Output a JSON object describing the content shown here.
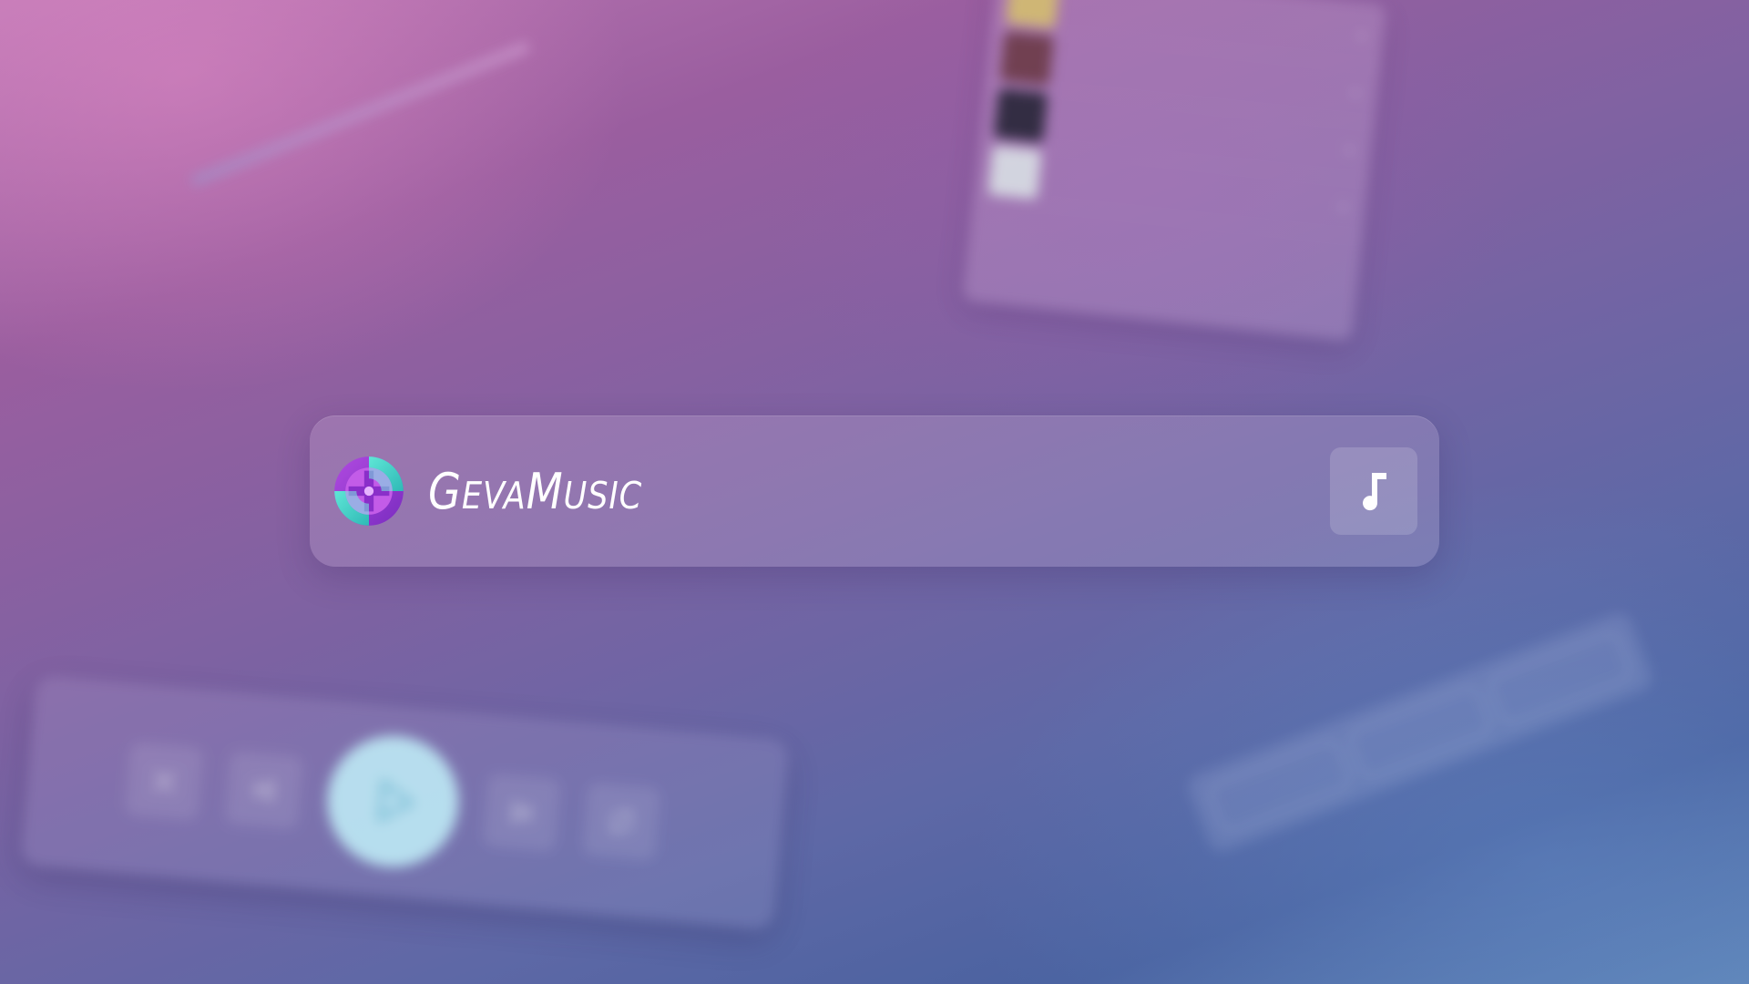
{
  "app": {
    "name_initial_1": "G",
    "name_rest_1": "EVA",
    "name_initial_2": "M",
    "name_rest_2": "USIC"
  },
  "icons": {
    "logo": "geva-logo-icon",
    "music_button": "music-note-icon",
    "playlist_remove": "close-icon",
    "controls": [
      "shuffle-icon",
      "previous-icon",
      "play-icon",
      "next-icon",
      "repeat-icon"
    ]
  },
  "colors": {
    "logo_purple": "#a43fd3",
    "logo_teal": "#3fd6c8",
    "play_button": "#c4f3fb"
  },
  "background_playlist": {
    "close_glyph": "×",
    "rows": [
      {
        "title": "",
        "subtitle": ""
      },
      {
        "title": "",
        "subtitle": ""
      },
      {
        "title": "",
        "subtitle": ""
      },
      {
        "title": "",
        "subtitle": ""
      },
      {
        "title": "",
        "subtitle": ""
      }
    ],
    "footer": ""
  },
  "background_tags": [
    "",
    "",
    ""
  ]
}
